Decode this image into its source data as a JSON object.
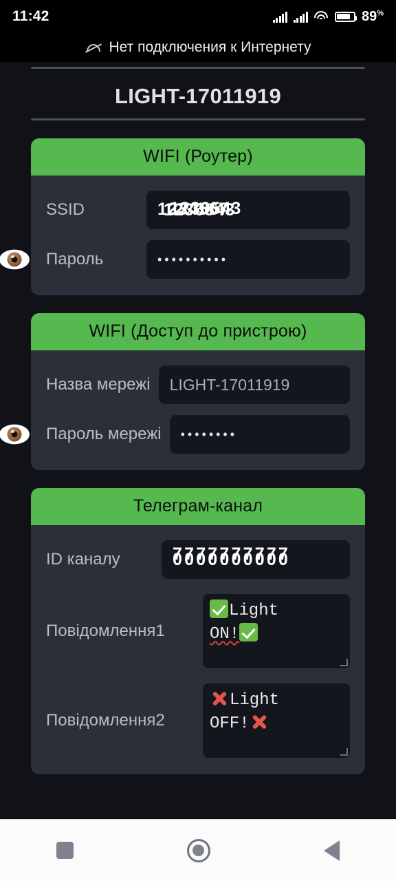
{
  "status_bar": {
    "time": "11:42",
    "battery_percent": "89",
    "percent_symbol": "%",
    "icons": [
      "signal-bars-icon",
      "signal-bars-icon",
      "wifi-icon",
      "battery-icon"
    ]
  },
  "notification": {
    "text": "Нет подключения к Интернету",
    "icon": "wifi-off-icon"
  },
  "app": {
    "title": "LIGHT-17011919",
    "accent_green": "#55b94f",
    "card_bg": "#2b2f3a",
    "field_bg": "#14161d",
    "page_bg": "#111218"
  },
  "cards": [
    {
      "header": "WIFI (Роутер)",
      "rows": [
        {
          "label": "SSID",
          "value": "1234567",
          "value_alt": "1236543",
          "value_alt2": "1230543",
          "obscured": true,
          "eye": false
        },
        {
          "label": "Пароль",
          "value": "••••••••••",
          "masked": true,
          "eye": true
        }
      ]
    },
    {
      "header": "WIFI (Доступ до пристрою)",
      "rows": [
        {
          "label": "Назва мережі",
          "value": "LIGHT-17011919",
          "truncated": true,
          "eye": false
        },
        {
          "label": "Пароль мережі",
          "value": "••••••••",
          "masked": true,
          "eye": true
        }
      ]
    },
    {
      "header": "Телеграм-канал",
      "rows": [
        {
          "label": "ID каналу",
          "value": "0000000000",
          "value_alt": "7777777777",
          "obscured": true,
          "eye": false
        },
        {
          "label": "Повідомлення1",
          "message_prefix_icon": "white-check-mark-emoji",
          "message_text_a": "Light",
          "message_text_b": "ON!",
          "message_suffix_icon": "white-check-mark-emoji",
          "spellcheck_error": "ON!"
        },
        {
          "label": "Повідомлення2",
          "message_prefix_icon": "cross-mark-emoji",
          "message_text_a": "Light",
          "message_text_b": "OFF!",
          "message_suffix_icon": "cross-mark-emoji"
        }
      ]
    }
  ],
  "nav_bar": {
    "buttons": [
      {
        "name": "recents-button",
        "icon": "square-icon"
      },
      {
        "name": "home-button",
        "icon": "circle-icon"
      },
      {
        "name": "back-button",
        "icon": "triangle-left-icon"
      }
    ]
  }
}
